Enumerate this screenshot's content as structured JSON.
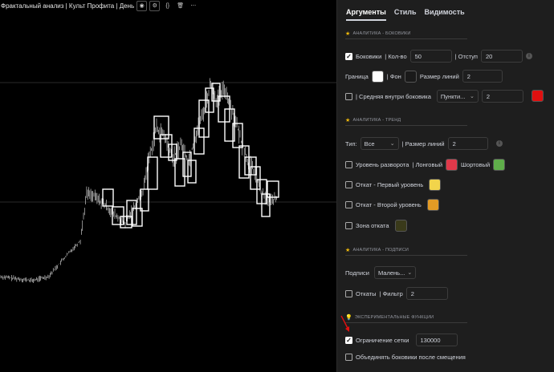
{
  "legend": {
    "title": "Фрактальный анализ | Культ Профита | День"
  },
  "tabs": [
    "Аргументы",
    "Стиль",
    "Видимость"
  ],
  "sections": {
    "sideways": "АНАЛИТИКА - БОКОВИКИ",
    "trend": "АНАЛИТИКА - ТРЕНД",
    "labels": "АНАЛИТИКА - ПОДПИСИ",
    "experimental": "ЭКСПЕРИМЕНТАЛЬНЫЕ ФУНКЦИИ"
  },
  "sideways": {
    "boxes_label": "Боковики",
    "count_label": "| Кол-во",
    "count_value": "50",
    "offset_label": "| Отступ",
    "offset_value": "20",
    "border_label": "Граница",
    "bg_label": "| Фон",
    "line_size_label": "Размер линий",
    "line_size_value": "2",
    "middle_label": "| Средняя внутри боковика",
    "middle_style": "Пункти...",
    "middle_width": "2",
    "colors": {
      "border": "#ffffff",
      "bg": "#1a1a1a",
      "middle": "#e01010"
    },
    "boxes_checked": true,
    "middle_checked": false
  },
  "trend": {
    "type_label": "Тип:",
    "type_value": "Все",
    "line_size_label": "| Размер линий",
    "line_size_value": "2",
    "reversal_label": "Уровень разворота",
    "long_label": "| Лонговый",
    "short_label": "Шортовый",
    "pullback1_label": "Откат - Первый уровень",
    "pullback2_label": "Откат - Второй уровень",
    "zone_label": "Зона отката",
    "colors": {
      "long": "#e0394a",
      "short": "#5fae4a",
      "pullback1": "#f2d44b",
      "pullback2": "#e39b25",
      "zone": "#3a3a1a"
    }
  },
  "labels": {
    "captions_label": "Подписи",
    "captions_value": "Малень...",
    "pullbacks_label": "Откаты",
    "filter_label": "| Фильтр",
    "filter_value": "2"
  },
  "experimental": {
    "grid_limit_label": "Ограничение сетки",
    "grid_limit_value": "130000",
    "grid_limit_checked": true,
    "merge_label": "Объединять боковики после смещения",
    "merge_checked": false
  },
  "info_glyph": "i",
  "check_glyph": "✓",
  "chevron_glyph": "⌄"
}
